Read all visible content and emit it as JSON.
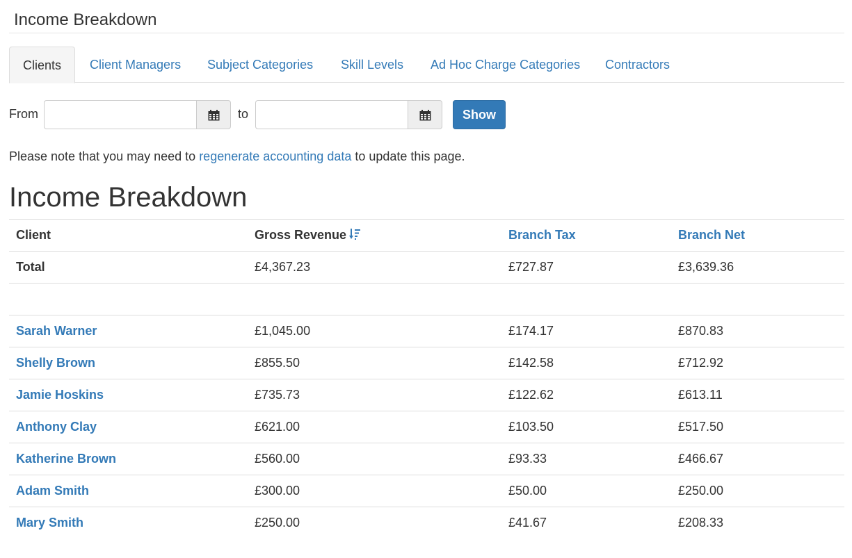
{
  "page_title": "Income Breakdown",
  "tabs": [
    {
      "label": "Clients",
      "active": true
    },
    {
      "label": "Client Managers",
      "active": false
    },
    {
      "label": "Subject Categories",
      "active": false
    },
    {
      "label": "Skill Levels",
      "active": false
    },
    {
      "label": "Ad Hoc Charge Categories",
      "active": false
    },
    {
      "label": "Contractors",
      "active": false
    }
  ],
  "filter": {
    "from_label": "From",
    "to_label": "to",
    "from_value": "",
    "to_value": "",
    "calendar_icon": "calendar-icon",
    "show_label": "Show"
  },
  "note": {
    "before": "Please note that you may need to ",
    "link": "regenerate accounting data",
    "after": " to update this page."
  },
  "heading": "Income Breakdown",
  "table": {
    "columns": [
      {
        "label": "Client",
        "sortable": false
      },
      {
        "label": "Gross Revenue",
        "sortable": true,
        "sorted": "descending",
        "icon": "sort-descending-icon"
      },
      {
        "label": "Branch Tax",
        "sortable": true
      },
      {
        "label": "Branch Net",
        "sortable": true
      }
    ],
    "total": {
      "label": "Total",
      "gross": "£4,367.23",
      "tax": "£727.87",
      "net": "£3,639.36"
    },
    "rows": [
      {
        "client": "Sarah Warner",
        "gross": "£1,045.00",
        "tax": "£174.17",
        "net": "£870.83"
      },
      {
        "client": "Shelly Brown",
        "gross": "£855.50",
        "tax": "£142.58",
        "net": "£712.92"
      },
      {
        "client": "Jamie Hoskins",
        "gross": "£735.73",
        "tax": "£122.62",
        "net": "£613.11"
      },
      {
        "client": "Anthony Clay",
        "gross": "£621.00",
        "tax": "£103.50",
        "net": "£517.50"
      },
      {
        "client": "Katherine Brown",
        "gross": "£560.00",
        "tax": "£93.33",
        "net": "£466.67"
      },
      {
        "client": "Adam Smith",
        "gross": "£300.00",
        "tax": "£50.00",
        "net": "£250.00"
      },
      {
        "client": "Mary Smith",
        "gross": "£250.00",
        "tax": "£41.67",
        "net": "£208.33"
      }
    ]
  },
  "colors": {
    "link": "#337ab7",
    "primary_button": "#337ab7",
    "text": "#333333",
    "border": "#dddddd"
  }
}
